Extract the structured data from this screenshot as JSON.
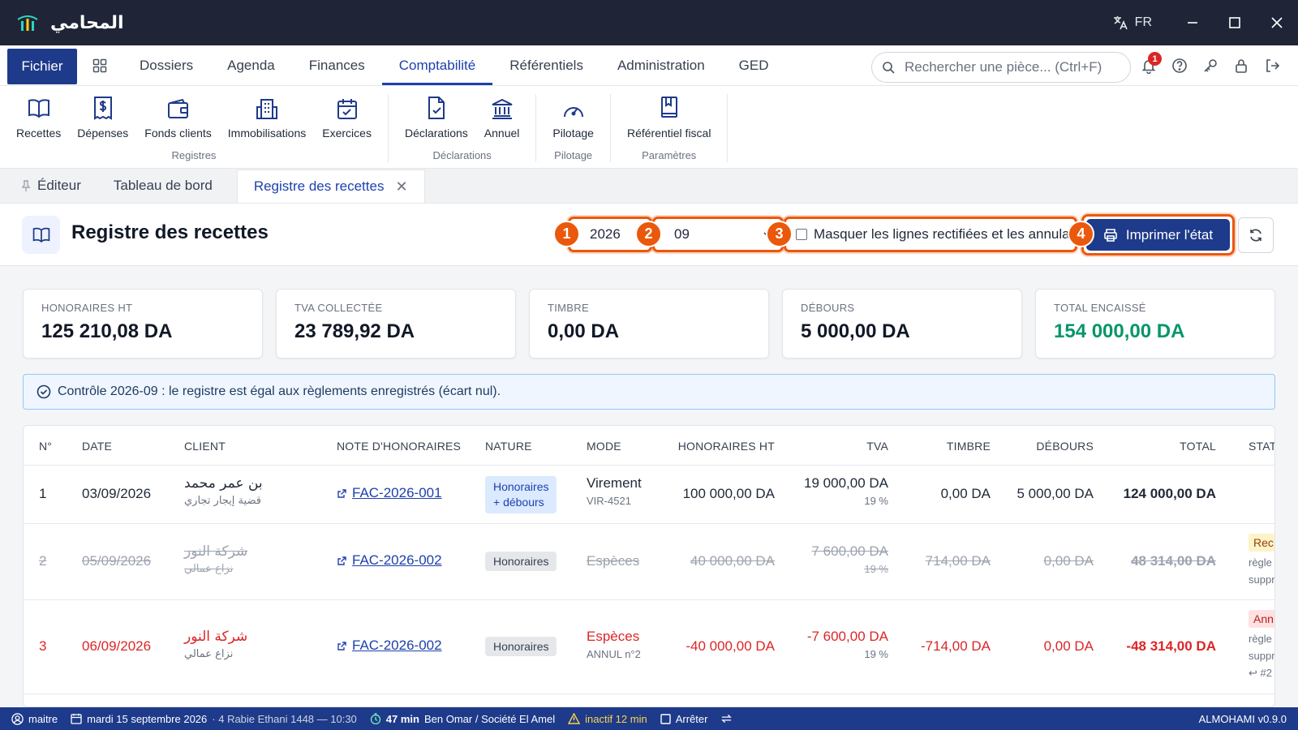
{
  "app": {
    "name": "المحامي",
    "lang": "FR"
  },
  "menu": {
    "file": "Fichier",
    "items": [
      "Dossiers",
      "Agenda",
      "Finances",
      "Comptabilité",
      "Référentiels",
      "Administration",
      "GED"
    ],
    "search_placeholder": "Rechercher une pièce... (Ctrl+F)",
    "notifications_count": "1"
  },
  "ribbon": {
    "groups": [
      {
        "label": "Registres",
        "items": [
          "Recettes",
          "Dépenses",
          "Fonds clients",
          "Immobilisations",
          "Exercices"
        ]
      },
      {
        "label": "Déclarations",
        "items": [
          "Déclarations",
          "Annuel"
        ]
      },
      {
        "label": "Pilotage",
        "items": [
          "Pilotage"
        ]
      },
      {
        "label": "Paramètres",
        "items": [
          "Référentiel fiscal"
        ]
      }
    ]
  },
  "tabs": {
    "editor": "Éditeur",
    "dashboard": "Tableau de bord",
    "active": "Registre des recettes"
  },
  "page": {
    "title": "Registre des recettes",
    "year": "2026",
    "month": "09",
    "mask_label": "Masquer les lignes rectifiées et les annulations",
    "print_label": "Imprimer l'état",
    "markers": [
      "1",
      "2",
      "3",
      "4"
    ]
  },
  "kpis": [
    {
      "label": "HONORAIRES HT",
      "value": "125 210,08 DA"
    },
    {
      "label": "TVA COLLECTÉE",
      "value": "23 789,92 DA"
    },
    {
      "label": "TIMBRE",
      "value": "0,00 DA"
    },
    {
      "label": "DÉBOURS",
      "value": "5 000,00 DA"
    },
    {
      "label": "TOTAL ENCAISSÉ",
      "value": "154 000,00 DA"
    }
  ],
  "alert": "Contrôle 2026-09 : le registre est égal aux règlements enregistrés (écart nul).",
  "table": {
    "headers": [
      "N°",
      "DATE",
      "CLIENT",
      "NOTE D'HONORAIRES",
      "NATURE",
      "MODE",
      "HONORAIRES HT",
      "TVA",
      "TIMBRE",
      "DÉBOURS",
      "TOTAL",
      "STAT"
    ],
    "rows": [
      {
        "num": "1",
        "date": "03/09/2026",
        "client": "بن عمر محمد",
        "client_sub": "قضية إيجار تجاري",
        "note": "FAC-2026-001",
        "nature_1": "Honoraires",
        "nature_2": "+ débours",
        "mode": "Virement",
        "mode_sub": "VIR-4521",
        "ht": "100 000,00 DA",
        "tva": "19 000,00 DA",
        "tva_rate": "19 %",
        "timbre": "0,00 DA",
        "debours": "5 000,00 DA",
        "total": "124 000,00 DA"
      },
      {
        "num": "2",
        "date": "05/09/2026",
        "client": "شركة النور",
        "client_sub": "نزاع عمالي",
        "note": "FAC-2026-002",
        "nature": "Honoraires",
        "mode": "Espèces",
        "ht": "40 000,00 DA",
        "tva": "7 600,00 DA",
        "tva_rate": "19 %",
        "timbre": "714,00 DA",
        "debours": "0,00 DA",
        "total": "48 314,00 DA",
        "stat": "Rec",
        "stat_sub_1": "règle",
        "stat_sub_2": "suppr"
      },
      {
        "num": "3",
        "date": "06/09/2026",
        "client": "شركة النور",
        "client_sub": "نزاع عمالي",
        "note": "FAC-2026-002",
        "nature": "Honoraires",
        "mode": "Espèces",
        "mode_sub": "ANNUL n°2",
        "ht": "-40 000,00 DA",
        "tva": "-7 600,00 DA",
        "tva_rate": "19 %",
        "timbre": "-714,00 DA",
        "debours": "0,00 DA",
        "total": "-48 314,00 DA",
        "stat": "Ann",
        "stat_sub_1": "règle",
        "stat_sub_2": "suppr",
        "stat_sub_3": "↩ #2"
      }
    ]
  },
  "statusbar": {
    "user": "maitre",
    "date": "mardi 15 septembre 2026",
    "hijri": "· 4 Rabie Ethani 1448 — 10:30",
    "timer": "47 min",
    "case": "Ben Omar / Société El Amel",
    "inactive": "inactif 12 min",
    "stop": "Arrêter",
    "version": "ALMOHAMI v0.9.0"
  },
  "colors": {
    "accent": "#1e3a8a",
    "highlight": "#ea580c",
    "positive": "#059669",
    "negative": "#dc2626"
  }
}
